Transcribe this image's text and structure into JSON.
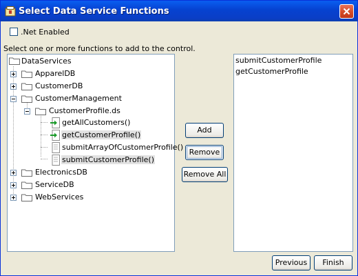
{
  "window": {
    "title": "Select Data Service Functions"
  },
  "options": {
    "net_enabled_label": ".Net Enabled",
    "net_enabled_checked": false
  },
  "instruction": "Select one or more functions to add to the control.",
  "tree": {
    "root": "DataServices",
    "nodes": {
      "appareldb": "ApparelDB",
      "customerdb": "CustomerDB",
      "customermanagement": "CustomerManagement",
      "customerprofile": "CustomerProfile.ds",
      "fn1": "getAllCustomers()",
      "fn2": "getCustomerProfile()",
      "fn3": "submitArrayOfCustomerProfile()",
      "fn4": "submitCustomerProfile()",
      "electronicsdb": "ElectronicsDB",
      "servicedb": "ServiceDB",
      "webservices": "WebServices"
    }
  },
  "buttons": {
    "add": "Add",
    "remove": "Remove",
    "remove_all": "Remove All",
    "previous": "Previous",
    "finish": "Finish"
  },
  "selected": [
    "submitCustomerProfile",
    "getCustomerProfile"
  ],
  "colors": {
    "titlebar": "#0a5ef0",
    "close": "#d44a27",
    "dialog_bg": "#ece9d8"
  }
}
